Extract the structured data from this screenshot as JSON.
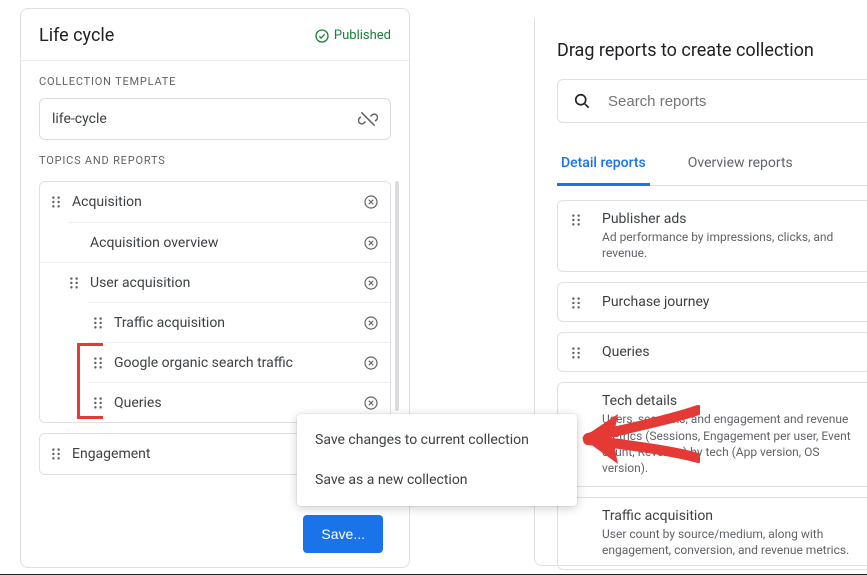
{
  "leftPanel": {
    "title": "Life cycle",
    "statusLabel": "Published",
    "templateSectionLabel": "COLLECTION TEMPLATE",
    "templateValue": "life-cycle",
    "topicsSectionLabel": "TOPICS AND REPORTS",
    "topics": [
      {
        "label": "Acquisition",
        "children": [
          {
            "label": "Acquisition overview",
            "hasDrag": false
          },
          {
            "label": "User acquisition",
            "hasDrag": true
          },
          {
            "label": "Traffic acquisition",
            "hasDrag": true
          },
          {
            "label": "Google organic search traffic",
            "hasDrag": true
          },
          {
            "label": "Queries",
            "hasDrag": true
          }
        ]
      },
      {
        "label": "Engagement",
        "children": []
      }
    ],
    "saveButton": "Save...",
    "saveMenu": {
      "option1": "Save changes to current collection",
      "option2": "Save as a new collection"
    }
  },
  "rightPanel": {
    "title": "Drag reports to create collection",
    "searchPlaceholder": "Search reports",
    "tabs": {
      "detail": "Detail reports",
      "overview": "Overview reports"
    },
    "cards": [
      {
        "name": "Publisher ads",
        "desc": "Ad performance by impressions, clicks, and revenue."
      },
      {
        "name": "Purchase journey",
        "desc": ""
      },
      {
        "name": "Queries",
        "desc": ""
      },
      {
        "name": "Tech details",
        "desc": "Users, sessions, and engagement and revenue metrics (Sessions, Engagement per user, Event count, Revenue) by tech (App version, OS version)."
      },
      {
        "name": "Traffic acquisition",
        "desc": "User count by source/medium, along with engagement, conversion, and revenue metrics."
      }
    ]
  }
}
